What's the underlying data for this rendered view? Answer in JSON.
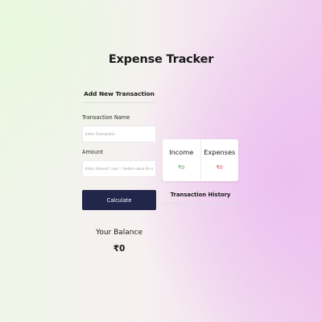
{
  "app": {
    "title": "Expense Tracker"
  },
  "form": {
    "heading": "Add New Transaction",
    "name_label": "Transaction Name",
    "name_placeholder": "Enter Transaction",
    "amount_label": "Amount",
    "amount_placeholder": "Enter Amount ( use '-' before value for expense )",
    "calculate_label": "Calculate"
  },
  "balance": {
    "label": "Your Balance",
    "value": "₹0"
  },
  "summary": {
    "income_label": "Income",
    "income_value": "₹0",
    "expenses_label": "Expenses",
    "expenses_value": "₹0"
  },
  "history": {
    "heading": "Transaction History"
  },
  "colors": {
    "button_bg": "#22264a",
    "income": "#3aa05a",
    "expense": "#d03a4a"
  }
}
